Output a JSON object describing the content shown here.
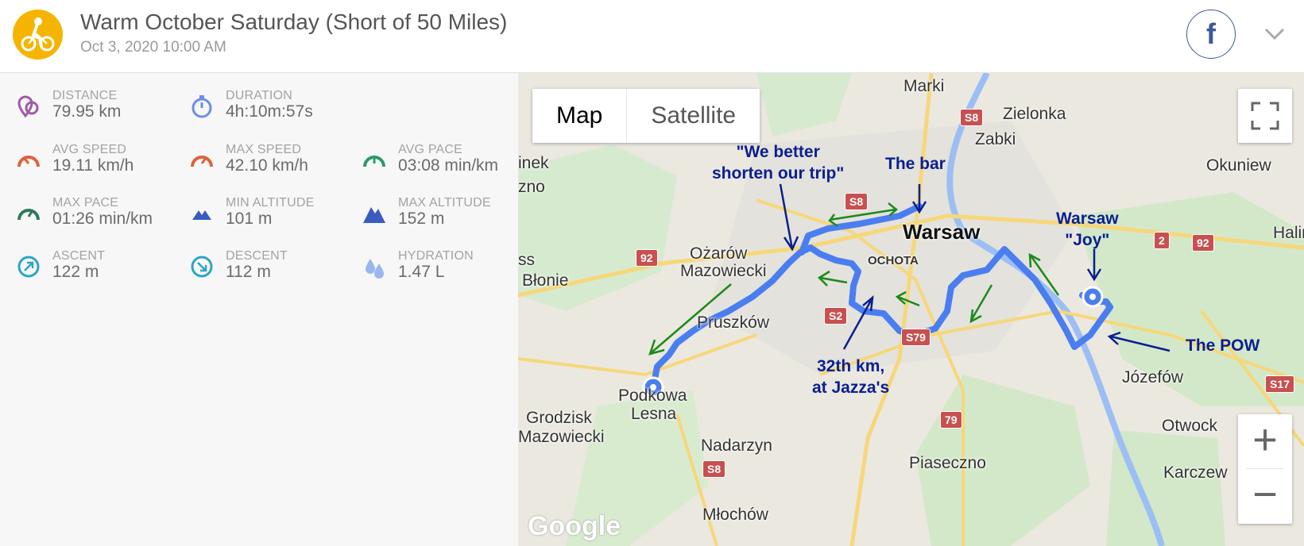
{
  "header": {
    "title": "Warm October Saturday (Short of 50 Miles)",
    "datetime": "Oct 3, 2020 10:00 AM",
    "activity_icon": "bicycle-icon",
    "share_label": "f",
    "colors": {
      "activity": "#f5b400",
      "facebook": "#3b5998"
    }
  },
  "stats": {
    "distance": {
      "label": "DISTANCE",
      "value": "79.95 km",
      "icon": "distance-pin-icon"
    },
    "duration": {
      "label": "DURATION",
      "value": "4h:10m:57s",
      "icon": "stopwatch-icon"
    },
    "avg_speed": {
      "label": "AVG SPEED",
      "value": "19.11 km/h",
      "icon": "speedometer-icon"
    },
    "max_speed": {
      "label": "MAX SPEED",
      "value": "42.10 km/h",
      "icon": "speedometer-icon"
    },
    "avg_pace": {
      "label": "AVG PACE",
      "value": "03:08 min/km",
      "icon": "pace-gauge-icon"
    },
    "max_pace": {
      "label": "MAX PACE",
      "value": "01:26 min/km",
      "icon": "pace-gauge-icon"
    },
    "min_altitude": {
      "label": "MIN ALTITUDE",
      "value": "101 m",
      "icon": "mountain-icon"
    },
    "max_altitude": {
      "label": "MAX ALTITUDE",
      "value": "152 m",
      "icon": "mountain-icon"
    },
    "ascent": {
      "label": "ASCENT",
      "value": "122 m",
      "icon": "ascent-arrow-icon"
    },
    "descent": {
      "label": "DESCENT",
      "value": "112 m",
      "icon": "descent-arrow-icon"
    },
    "hydration": {
      "label": "HYDRATION",
      "value": "1.47 L",
      "icon": "water-drops-icon"
    }
  },
  "map": {
    "type_buttons": [
      "Map",
      "Satellite"
    ],
    "active_type": "Map",
    "zoom_in": "+",
    "zoom_out": "−",
    "attribution": "Google",
    "places": {
      "warsaw": "Warsaw",
      "marki": "Marki",
      "zielonka": "Zielonka",
      "zabki": "Zabki",
      "okuniew": "Okuniew",
      "halin": "Halin",
      "ozarow": "Ożarów",
      "mazowiecki": "Mazowiecki",
      "ochota": "OCHOTA",
      "pruszkow": "Pruszków",
      "blonie": "Błonie",
      "podkowa": "Podkowa",
      "lesna": "Lesna",
      "grodzisk": "Grodzisk",
      "grodzisk2": "Mazowiecki",
      "nadarzyn": "Nadarzyn",
      "piaseczno": "Piaseczno",
      "jozefow": "Józefów",
      "otwock": "Otwock",
      "karczew": "Karczew",
      "mlochow": "Młochów",
      "inek": "inek",
      "zno": "zno",
      "ss": "ss"
    },
    "roads": {
      "s8a": "S8",
      "s8b": "S8",
      "s8c": "S8",
      "r92a": "92",
      "r92b": "92",
      "r2": "2",
      "s2": "S2",
      "s79": "S79",
      "r79": "79",
      "s17": "S17"
    },
    "annotations": {
      "shorten1": "\"We better",
      "shorten2": "shorten our trip\"",
      "bar": "The bar",
      "joy1": "Warsaw",
      "joy2": "\"Joy\"",
      "pow": "The POW",
      "km1": "32th km,",
      "km2": "at Jazza's"
    },
    "colors": {
      "route": "#4a7ef0",
      "annotation": "#0a1f8f",
      "direction_arrows": "#1a8a1a",
      "river": "#9bbff4"
    }
  }
}
